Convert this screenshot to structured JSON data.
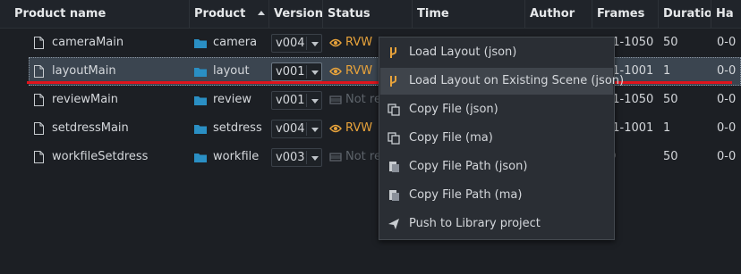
{
  "columns": {
    "product_name": "Product name",
    "product": "Product",
    "version": "Version",
    "status": "Status",
    "time": "Time",
    "author": "Author",
    "frames": "Frames",
    "duration": "Duratio",
    "handles": "Ha"
  },
  "rows": [
    {
      "name": "cameraMain",
      "product": "camera",
      "version": "v004",
      "status": "RVW",
      "status_kind": "rvw",
      "frames": "01-1050",
      "duration": "50",
      "handles": "0-0"
    },
    {
      "name": "layoutMain",
      "product": "layout",
      "version": "v001",
      "status": "RVW",
      "status_kind": "rvw",
      "frames": "01-1001",
      "duration": "1",
      "handles": "0-0"
    },
    {
      "name": "reviewMain",
      "product": "review",
      "version": "v001",
      "status": "Not re",
      "status_kind": "na",
      "frames": "01-1050",
      "duration": "50",
      "handles": "0-0"
    },
    {
      "name": "setdressMain",
      "product": "setdress",
      "version": "v004",
      "status": "RVW",
      "status_kind": "rvw",
      "frames": "01-1001",
      "duration": "1",
      "handles": "0-0"
    },
    {
      "name": "workfileSetdress",
      "product": "workfile",
      "version": "v003",
      "status": "Not re",
      "status_kind": "na",
      "frames": "0",
      "duration": "50",
      "handles": "0-0"
    }
  ],
  "context_menu": {
    "items": [
      {
        "label": "Load Layout (json)",
        "icon": "loader-icon"
      },
      {
        "label": "Load Layout on Existing Scene (json)",
        "icon": "loader-icon"
      },
      {
        "label": "Copy File (json)",
        "icon": "copy-icon"
      },
      {
        "label": "Copy File (ma)",
        "icon": "copy-icon"
      },
      {
        "label": "Copy File Path (json)",
        "icon": "clipboard-icon"
      },
      {
        "label": "Copy File Path (ma)",
        "icon": "clipboard-icon"
      },
      {
        "label": "Push to Library project",
        "icon": "send-icon"
      }
    ]
  },
  "colors": {
    "background": "#1c1f24",
    "selection": "#3b4550",
    "status_rvw": "#e8a33b",
    "folder": "#2a8fc4",
    "highlight_line": "#e0141c"
  }
}
